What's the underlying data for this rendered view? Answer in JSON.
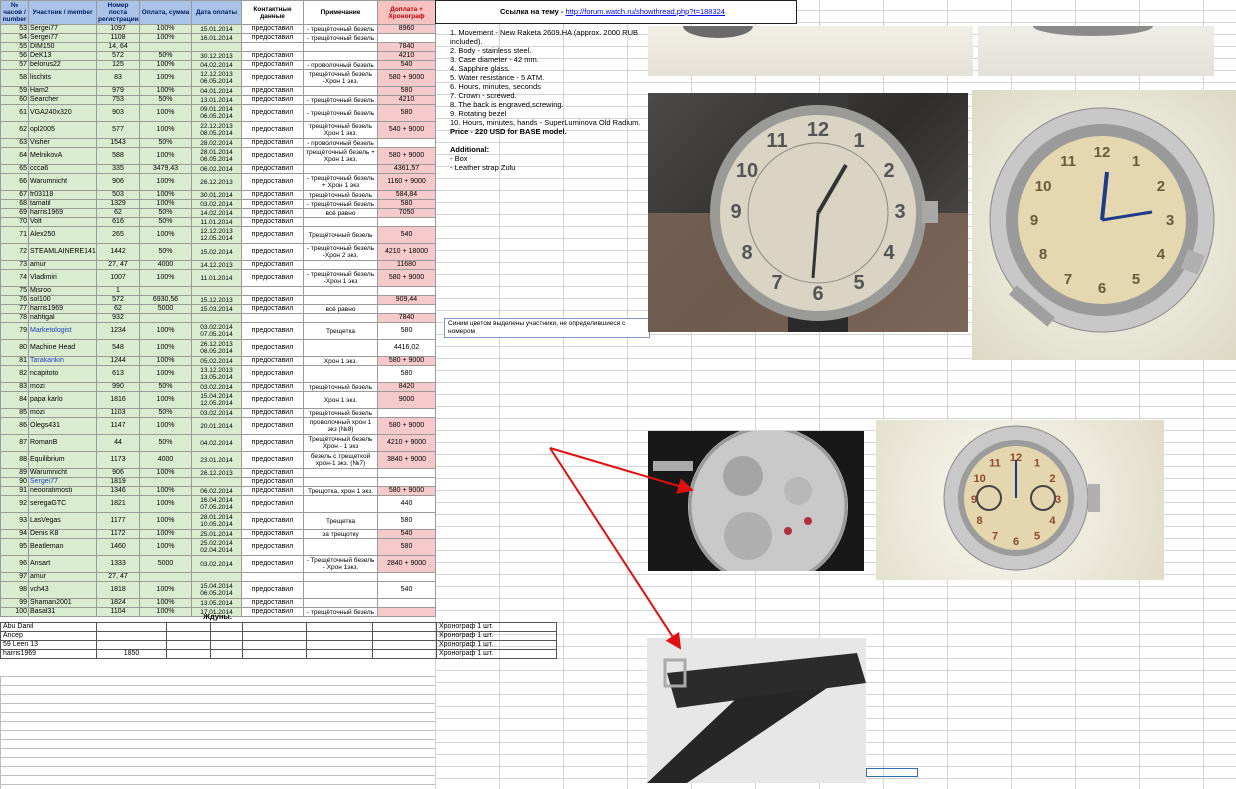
{
  "headers": {
    "num": "№ часов / number",
    "member": "Участник / member",
    "post": "Номер поста регистрации",
    "paid": "Оплата, сумма",
    "date": "Дата оплаты",
    "contact": "Контактные данные",
    "note": "Примечание",
    "extra": "Доплата + Хронограф"
  },
  "rows": [
    {
      "n": "53",
      "m": "Sergei77",
      "p": "1097",
      "pay": "100%",
      "d": "15.01.2014",
      "c": "предоставил",
      "nt": "- трещёточный безель",
      "x": "8960",
      "xp": true
    },
    {
      "n": "54",
      "m": "Sergei77",
      "p": "1108",
      "pay": "100%",
      "d": "16.01.2014",
      "c": "предоставил",
      "nt": "- трещёточный безель",
      "x": "",
      "xp": false
    },
    {
      "n": "55",
      "m": "DIM150",
      "p": "14, 64",
      "pay": "",
      "d": "",
      "c": "",
      "nt": "",
      "x": "7840",
      "xp": true
    },
    {
      "n": "56",
      "m": "DeK13",
      "p": "572",
      "pay": "50%",
      "d": "30.12.2013",
      "c": "предоставил",
      "nt": "",
      "x": "4210",
      "xp": true
    },
    {
      "n": "57",
      "m": "belorus22",
      "p": "125",
      "pay": "100%",
      "d": "04.02.2014",
      "c": "предоставил",
      "nt": "- проволочный безель",
      "x": "540",
      "xp": true
    },
    {
      "n": "58",
      "m": "lischits",
      "p": "83",
      "pay": "100%",
      "d": "12.12.2013 06.05.2014",
      "c": "предоставил",
      "nt": "трещёточный безель -Хрон 1 экз.",
      "x": "580 + 9000",
      "xp": true,
      "tall": true
    },
    {
      "n": "59",
      "m": "Ham2",
      "p": "979",
      "pay": "100%",
      "d": "04.01.2014",
      "c": "предоставил",
      "nt": "",
      "x": "580",
      "xp": true
    },
    {
      "n": "60",
      "m": "Searcher",
      "p": "753",
      "pay": "50%",
      "d": "13.01.2014",
      "c": "предоставил",
      "nt": "- трещёточный безель",
      "x": "4210",
      "xp": true
    },
    {
      "n": "61",
      "m": "VGA240x320",
      "p": "903",
      "pay": "100%",
      "d": "09.01.2014 06.05.2014",
      "c": "предоставил",
      "nt": "- трещёточный безель",
      "x": "580",
      "xp": true,
      "tall": true
    },
    {
      "n": "62",
      "m": "opl2005",
      "p": "577",
      "pay": "100%",
      "d": "22.12.2013 08.05.2014",
      "c": "предоставил",
      "nt": "трещёточный безель Хрон 1 экз.",
      "x": "540 + 9000",
      "xp": true,
      "tall": true
    },
    {
      "n": "63",
      "m": "Visher",
      "p": "1543",
      "pay": "50%",
      "d": "28.02.2014",
      "c": "предоставил",
      "nt": "- проволочный безель",
      "x": "",
      "xp": false
    },
    {
      "n": "64",
      "m": "MelnikovA",
      "p": "588",
      "pay": "100%",
      "d": "28.01.2014 06.05.2014",
      "c": "предоставил",
      "nt": "трещёточный безель + Хрон 1 экз.",
      "x": "580 + 9000",
      "xp": true,
      "tall": true
    },
    {
      "n": "65",
      "m": "ccca6",
      "p": "335",
      "pay": "3479,43",
      "d": "06.02.2014",
      "c": "предоставил",
      "nt": "",
      "x": "4361,57",
      "xp": true
    },
    {
      "n": "66",
      "m": "Warumnicht",
      "p": "906",
      "pay": "100%",
      "d": "26.12.2013",
      "c": "предоставил",
      "nt": "- трещёточный безель + Хрон 1 экз",
      "x": "1160 + 9000",
      "xp": true,
      "tall": true
    },
    {
      "n": "67",
      "m": "fr03118",
      "p": "503",
      "pay": "100%",
      "d": "30.01.2014",
      "c": "предоставил",
      "nt": "трещёточный безель",
      "x": "584,84",
      "xp": true
    },
    {
      "n": "68",
      "m": "tamatil",
      "p": "1329",
      "pay": "100%",
      "d": "03.02.2014",
      "c": "предоставил",
      "nt": "- трещёточный безель",
      "x": "580",
      "xp": true
    },
    {
      "n": "69",
      "m": "harris1969",
      "p": "62",
      "pay": "50%",
      "d": "14.02.2014",
      "c": "предоставил",
      "nt": "всё равно",
      "x": "7050",
      "xp": true
    },
    {
      "n": "70",
      "m": "Volt",
      "p": "616",
      "pay": "50%",
      "d": "11.01.2014",
      "c": "предоставил",
      "nt": "",
      "x": "",
      "xp": false
    },
    {
      "n": "71",
      "m": "Alex250",
      "p": "265",
      "pay": "100%",
      "d": "12.12.2013 12.05.2014",
      "c": "предоставил",
      "nt": "Трещёточный безель",
      "x": "540",
      "xp": true,
      "tall": true
    },
    {
      "n": "72",
      "m": "STEAMLAINERE141",
      "p": "1442",
      "pay": "50%",
      "d": "15.02.2014",
      "c": "предоставил",
      "nt": "- трещёточный безель -Хрон 2 экз.",
      "x": "4210 + 18000",
      "xp": true,
      "tall": true
    },
    {
      "n": "73",
      "m": "amur",
      "p": "27, 47",
      "pay": "4000",
      "d": "14.12.2013",
      "c": "предоставил",
      "nt": "",
      "x": "11680",
      "xp": true
    },
    {
      "n": "74",
      "m": "Vladimiri",
      "p": "1007",
      "pay": "100%",
      "d": "11.01.2014",
      "c": "предоставил",
      "nt": "- трещёточный безель -Хрон 1 экз",
      "x": "580 + 9000",
      "xp": true,
      "tall": true
    },
    {
      "n": "75",
      "m": "Misroo",
      "p": "1",
      "pay": "",
      "d": "",
      "c": "",
      "nt": "",
      "x": "",
      "xp": false
    },
    {
      "n": "76",
      "m": "sol100",
      "p": "572",
      "pay": "6930,56",
      "d": "15.12.2013",
      "c": "предоставил",
      "nt": "",
      "x": "909,44",
      "xp": true
    },
    {
      "n": "77",
      "m": "harris1969",
      "p": "62",
      "pay": "5000",
      "d": "15.03.2014",
      "c": "предоставил",
      "nt": "всё равно",
      "x": "",
      "xp": false
    },
    {
      "n": "78",
      "m": "nahtigal",
      "p": "932",
      "pay": "",
      "d": "",
      "c": "",
      "nt": "",
      "x": "7840",
      "xp": true
    },
    {
      "n": "79",
      "m": "Marketologist",
      "p": "1234",
      "pay": "100%",
      "d": "03.02.2014 07.05.2014",
      "c": "предоставил",
      "nt": "Трещетка",
      "x": "580",
      "xp": false,
      "tall": true,
      "blue": true
    },
    {
      "n": "80",
      "m": "Machine Head",
      "p": "548",
      "pay": "100%",
      "d": "26.12.2013 06.05.2014",
      "c": "предоставил",
      "nt": "",
      "x": "4416,02",
      "xp": false,
      "tall": true
    },
    {
      "n": "81",
      "m": "Tarakankin",
      "p": "1244",
      "pay": "100%",
      "d": "05.02.2014",
      "c": "предоставил",
      "nt": "Хрон 1 экз.",
      "x": "580 + 9000",
      "xp": true,
      "blue": true
    },
    {
      "n": "82",
      "m": "ncapitoto",
      "p": "613",
      "pay": "100%",
      "d": "13.12.2013 13.05.2014",
      "c": "предоставил",
      "nt": "",
      "x": "580",
      "xp": false,
      "tall": true
    },
    {
      "n": "83",
      "m": "mozi",
      "p": "990",
      "pay": "50%",
      "d": "03.02.2014",
      "c": "предоставил",
      "nt": "трещёточный безель",
      "x": "8420",
      "xp": true
    },
    {
      "n": "84",
      "m": "papa karlo",
      "p": "1816",
      "pay": "100%",
      "d": "15.04.2014 12.05.2014",
      "c": "предоставил",
      "nt": "Хрон 1 экз.",
      "x": "9000",
      "xp": true,
      "tall": true
    },
    {
      "n": "85",
      "m": "mozi",
      "p": "1103",
      "pay": "50%",
      "d": "03.02.2014",
      "c": "предоставил",
      "nt": "трещёточный безель",
      "x": "",
      "xp": false
    },
    {
      "n": "86",
      "m": "Olegs431",
      "p": "1147",
      "pay": "100%",
      "d": "20.01.2014",
      "c": "предоставил",
      "nt": "проволочный хрон 1 экз (№8)",
      "x": "580 + 9000",
      "xp": true,
      "tall": true
    },
    {
      "n": "87",
      "m": "RomanB",
      "p": "44",
      "pay": "50%",
      "d": "04.02.2014",
      "c": "предоставил",
      "nt": "Трещёточный безель Хрон - 1 экз",
      "x": "4210 + 9000",
      "xp": true,
      "tall": true
    },
    {
      "n": "88",
      "m": "Equilibrium",
      "p": "1173",
      "pay": "4000",
      "d": "23.01.2014",
      "c": "предоставил",
      "nt": "безель с трещеткой хрон-1 экз. (№7)",
      "x": "3840 + 9000",
      "xp": true,
      "tall": true
    },
    {
      "n": "89",
      "m": "Warumnicht",
      "p": "906",
      "pay": "100%",
      "d": "26.12.2013",
      "c": "предоставил",
      "nt": "",
      "x": "",
      "xp": false
    },
    {
      "n": "90",
      "m": "Sergei77",
      "p": "1819",
      "pay": "",
      "d": "",
      "c": "предоставил",
      "nt": "",
      "x": "",
      "xp": false,
      "blue": true
    },
    {
      "n": "91",
      "m": "neooratimosti",
      "p": "1346",
      "pay": "100%",
      "d": "06.02.2014",
      "c": "предоставил",
      "nt": "Трещотка, хрон 1 экз.",
      "x": "580 + 9000",
      "xp": true
    },
    {
      "n": "92",
      "m": "seregaGTC",
      "p": "1821",
      "pay": "100%",
      "d": "16.04.2014 07.05.2014",
      "c": "предоставил",
      "nt": "",
      "x": "440",
      "xp": false,
      "tall": true
    },
    {
      "n": "93",
      "m": "LasVegas",
      "p": "1177",
      "pay": "100%",
      "d": "28.01.2014 10.05.2014",
      "c": "предоставил",
      "nt": "Трещетка",
      "x": "580",
      "xp": false,
      "tall": true
    },
    {
      "n": "94",
      "m": "Denis K8",
      "p": "1172",
      "pay": "100%",
      "d": "25.01.2014",
      "c": "предоставил",
      "nt": "за трещотку",
      "x": "540",
      "xp": true
    },
    {
      "n": "95",
      "m": "Beatleman",
      "p": "1460",
      "pay": "100%",
      "d": "25.02.2014 02.04.2014",
      "c": "предоставил",
      "nt": "",
      "x": "580",
      "xp": true,
      "tall": true
    },
    {
      "n": "96",
      "m": "Ansart",
      "p": "1333",
      "pay": "5000",
      "d": "03.02.2014",
      "c": "предоставил",
      "nt": "- Трещёточный безель - Хрон 1экз.",
      "x": "2840 + 9000",
      "xp": true,
      "tall": true
    },
    {
      "n": "97",
      "m": "amur",
      "p": "27, 47",
      "pay": "",
      "d": "",
      "c": "",
      "nt": "",
      "x": "",
      "xp": false
    },
    {
      "n": "98",
      "m": "vch43",
      "p": "1818",
      "pay": "100%",
      "d": "15.04.2014 06.05.2014",
      "c": "предоставил",
      "nt": "",
      "x": "540",
      "xp": false,
      "tall": true
    },
    {
      "n": "99",
      "m": "Shaman2001",
      "p": "1824",
      "pay": "100%",
      "d": "13.05.2014",
      "c": "предоставил",
      "nt": "",
      "x": "",
      "xp": false
    },
    {
      "n": "100",
      "m": "Basal31",
      "p": "1104",
      "pay": "100%",
      "d": "17.01.2014",
      "c": "предоставил",
      "nt": "- трещёточный безель",
      "x": "",
      "xp": true
    }
  ],
  "waiting": {
    "title": "Ждуны.",
    "rows": [
      {
        "m": "Abu Danil",
        "p": "",
        "nt": "Хронограф 1 шт."
      },
      {
        "m": "Ancep",
        "p": "",
        "nt": "Хронограф 1 шт."
      },
      {
        "m": "59 Leen 13",
        "p": "",
        "nt": "Хронограф 1 шт."
      },
      {
        "m": "harris1969",
        "p": "1850",
        "nt": "Хронограф 1 шт."
      }
    ]
  },
  "link": {
    "label": "Ссылка на тему -",
    "url": "http://forum.watch.ru/showthread.php?t=188324"
  },
  "specs": [
    "1. Movement - New Raketa 2609.HA (approx. 2000 RUB included).",
    "2. Body - stainless steel.",
    "3. Case diameter - 42 mm.",
    "4. Sapphire glass.",
    "5. Water resistance - 5 ATM.",
    "6. Hours, minutes, seconds",
    "7. Crown - screwed.",
    "8. The back is engraved,screwing.",
    "9. Rotating bezel",
    "10. Hours, minutes, hands - SuperLuminova Old Radium."
  ],
  "price": "Price - 220 USD for BASE model.",
  "additional_title": "Additional:",
  "additional": [
    "- Box",
    "- Leather strap Zulu"
  ],
  "note": "Синим цветом выделены участники, не определившиеся с номером",
  "dial": [
    "12",
    "3",
    "6",
    "9",
    "1",
    "2",
    "4",
    "5",
    "7",
    "8",
    "10",
    "11"
  ],
  "colors": {
    "header": "#a9c4e8",
    "row": "#d9ecd0",
    "extra": "#f6caca",
    "arrow": "#e01010",
    "blue_member": "#1f3fbf"
  }
}
